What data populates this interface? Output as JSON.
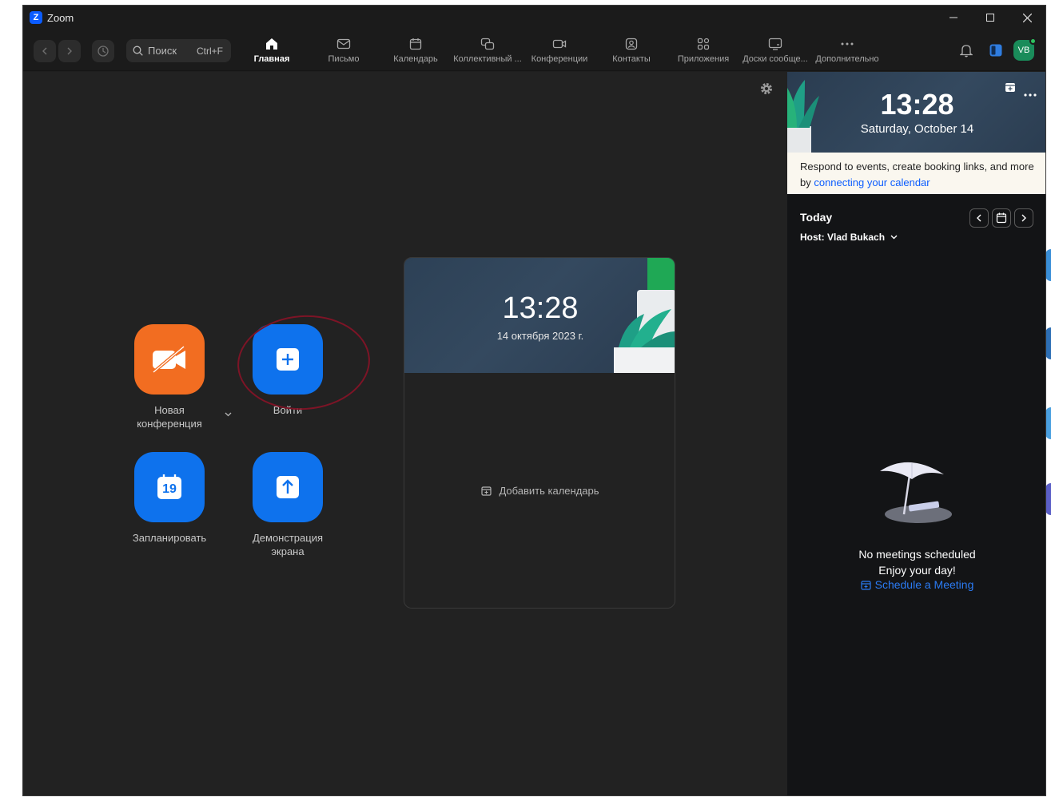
{
  "window": {
    "title": "Zoom",
    "minimize_icon": "minimize-icon",
    "maximize_icon": "maximize-icon",
    "close_icon": "close-icon"
  },
  "toolbar": {
    "search_placeholder": "Поиск",
    "search_shortcut": "Ctrl+F",
    "tabs": [
      {
        "label": "Главная",
        "icon": "home-icon",
        "active": true
      },
      {
        "label": "Письмо",
        "icon": "mail-icon"
      },
      {
        "label": "Календарь",
        "icon": "calendar-icon"
      },
      {
        "label": "Коллективный ...",
        "icon": "chat-icon"
      },
      {
        "label": "Конференции",
        "icon": "video-icon"
      },
      {
        "label": "Контакты",
        "icon": "contacts-icon"
      },
      {
        "label": "Приложения",
        "icon": "apps-icon"
      },
      {
        "label": "Доски сообще...",
        "icon": "whiteboard-icon"
      },
      {
        "label": "Дополнительно",
        "icon": "more-icon"
      }
    ],
    "avatar_initials": "VB"
  },
  "actions": {
    "new_meeting": "Новая\nконференция",
    "join": "Войти",
    "schedule": "Запланировать",
    "schedule_day": "19",
    "share_screen": "Демонстрация\nэкрана"
  },
  "calendar_card": {
    "time": "13:28",
    "date": "14 октября 2023 г.",
    "add_calendar": "Добавить календарь"
  },
  "right_panel": {
    "time": "13:28",
    "date": "Saturday, October 14",
    "info_text": "Respond to events, create booking links, and more by ",
    "info_link": "connecting your calendar",
    "today": "Today",
    "host_label": "Host:",
    "host_name": "Vlad Bukach",
    "no_meetings": "No meetings scheduled",
    "enjoy": "Enjoy your day!",
    "schedule_meeting": "Schedule a Meeting"
  },
  "colors": {
    "accent": "#0e72ed",
    "orange": "#f26d21",
    "link": "#2b7bf4",
    "highlight": "#7d1426"
  }
}
